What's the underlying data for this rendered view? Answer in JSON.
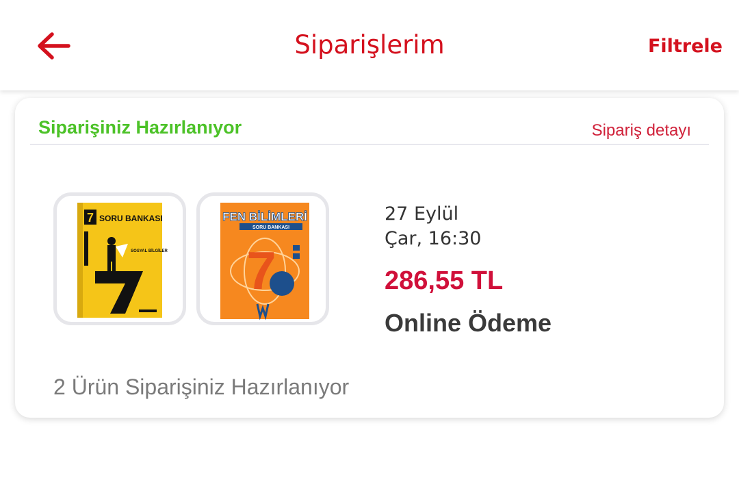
{
  "header": {
    "title": "Siparişlerim",
    "filter_label": "Filtrele"
  },
  "order": {
    "status": "Siparişiniz Hazırlanıyor",
    "detail_link": "Sipariş detayı",
    "date": "27 Eylül",
    "day_time": "Çar, 16:30",
    "price": "286,55 TL",
    "payment_method": "Online Ödeme",
    "summary": "2 Ürün Siparişiniz Hazırlanıyor",
    "products": [
      {
        "cover_title": "SORU BANKASI",
        "cover_grade": "7",
        "cover_subject": "SOSYAL BİLGİLER"
      },
      {
        "cover_title": "FEN BİLİMLERİ",
        "cover_subtitle": "SORU BANKASI",
        "cover_grade": "7"
      }
    ]
  },
  "colors": {
    "brand_red": "#d4111e",
    "status_green": "#4cc228",
    "price_red": "#d0103a"
  },
  "icons": {
    "back": "arrow-left-icon"
  }
}
